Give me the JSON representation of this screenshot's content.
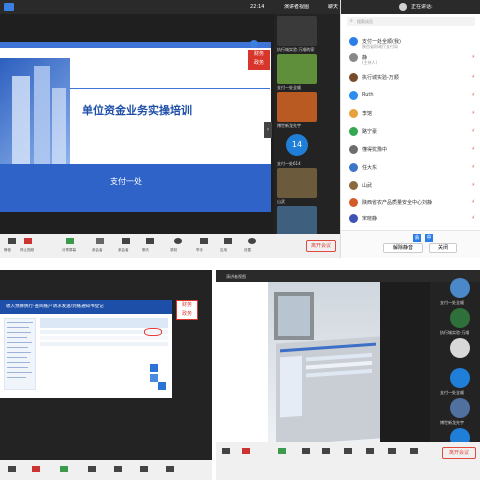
{
  "top_meeting": {
    "clock": "22:14",
    "view_mode": "演讲者视图",
    "chat_tab": "聊天",
    "slide_title": "单位资金业务实操培训",
    "slide_subtitle": "支付一处",
    "logo_text": "财务\n政务",
    "stream_watermark": "宏新",
    "gallery": [
      {
        "label": "执行城实验-万顺的家",
        "color": "#3a3a3a"
      },
      {
        "label": "支付一处全顺",
        "color": "#5f8f3a"
      },
      {
        "label": "博世新龙先宇",
        "color": "#b85a22"
      },
      {
        "label": "支付一处614",
        "color": "#1f7fd8",
        "initial": "14"
      },
      {
        "label": "山武",
        "color": "#6b5a3c"
      },
      {
        "label": "",
        "color": "#3f5f7f"
      }
    ],
    "leave_button": "离开会议",
    "toolbar": [
      "静音",
      "停止视频",
      "分享屏幕",
      "参会者",
      "聊天",
      "录制",
      "举手",
      "应用",
      "设置"
    ]
  },
  "panel": {
    "search_placeholder": "搜索成员",
    "header_title": "正在讲话:",
    "participants": [
      {
        "name": "支付一处全顺(我)",
        "sub": "陕西省财政厅支付局",
        "color": "#2b7de9",
        "muted": false
      },
      {
        "name": "静",
        "sub": "(主持人)",
        "color": "#888888",
        "muted": true
      },
      {
        "name": "执行城实验-万顺",
        "color": "#7a4b2a",
        "muted": true
      },
      {
        "name": "Ruth",
        "color": "#2d8cf0",
        "muted": true
      },
      {
        "name": "李馆",
        "color": "#e8a03c",
        "muted": true
      },
      {
        "name": "路宁豪",
        "color": "#34a853",
        "muted": true
      },
      {
        "name": "懂得犹豫中",
        "color": "#6d6d6d",
        "muted": true
      },
      {
        "name": "任大东",
        "color": "#3a77c8",
        "muted": true
      },
      {
        "name": "山武",
        "color": "#8b6b3d",
        "muted": true
      },
      {
        "name": "陕西省农产品质量安全中心刘静",
        "color": "#d35b2a",
        "muted": true
      },
      {
        "name": "宋晓静",
        "color": "#3f51b5",
        "muted": true
      },
      {
        "name": "",
        "color": "#999999",
        "muted": true
      }
    ],
    "mute_all": "解除静音",
    "close_all": "关闭",
    "footer_icons": [
      "会",
      "中"
    ]
  },
  "bl": {
    "slide_title": "收入预算执行-查阅账户请求发送/到账通知书登记",
    "logo_text": "财务\n政务",
    "tree_items": 14,
    "gallery": [
      {
        "label": "支付一处全顺",
        "color": "#4a88c8"
      },
      {
        "label": "执行城实验-万顺",
        "color": "#2f6f3a"
      },
      {
        "label": "",
        "color": "#d8d8d8"
      },
      {
        "label": "",
        "color": "#c9a24a"
      },
      {
        "label": "博世新龙",
        "color": "#5070a0"
      }
    ],
    "leave_button": "离开会议"
  },
  "br": {
    "title": "演讲者视图",
    "gallery": [
      {
        "label": "支付一处全顺",
        "color": "#4a88c8"
      },
      {
        "label": "执行城实验-万顺",
        "color": "#2f6f3a"
      },
      {
        "label": "",
        "color": "#d8d8d8"
      },
      {
        "label": "支付一处全顺",
        "color": "#1f7fd8"
      },
      {
        "label": "博世新龙先宇",
        "color": "#5070a0"
      }
    ],
    "leave_button": "离开会议"
  }
}
